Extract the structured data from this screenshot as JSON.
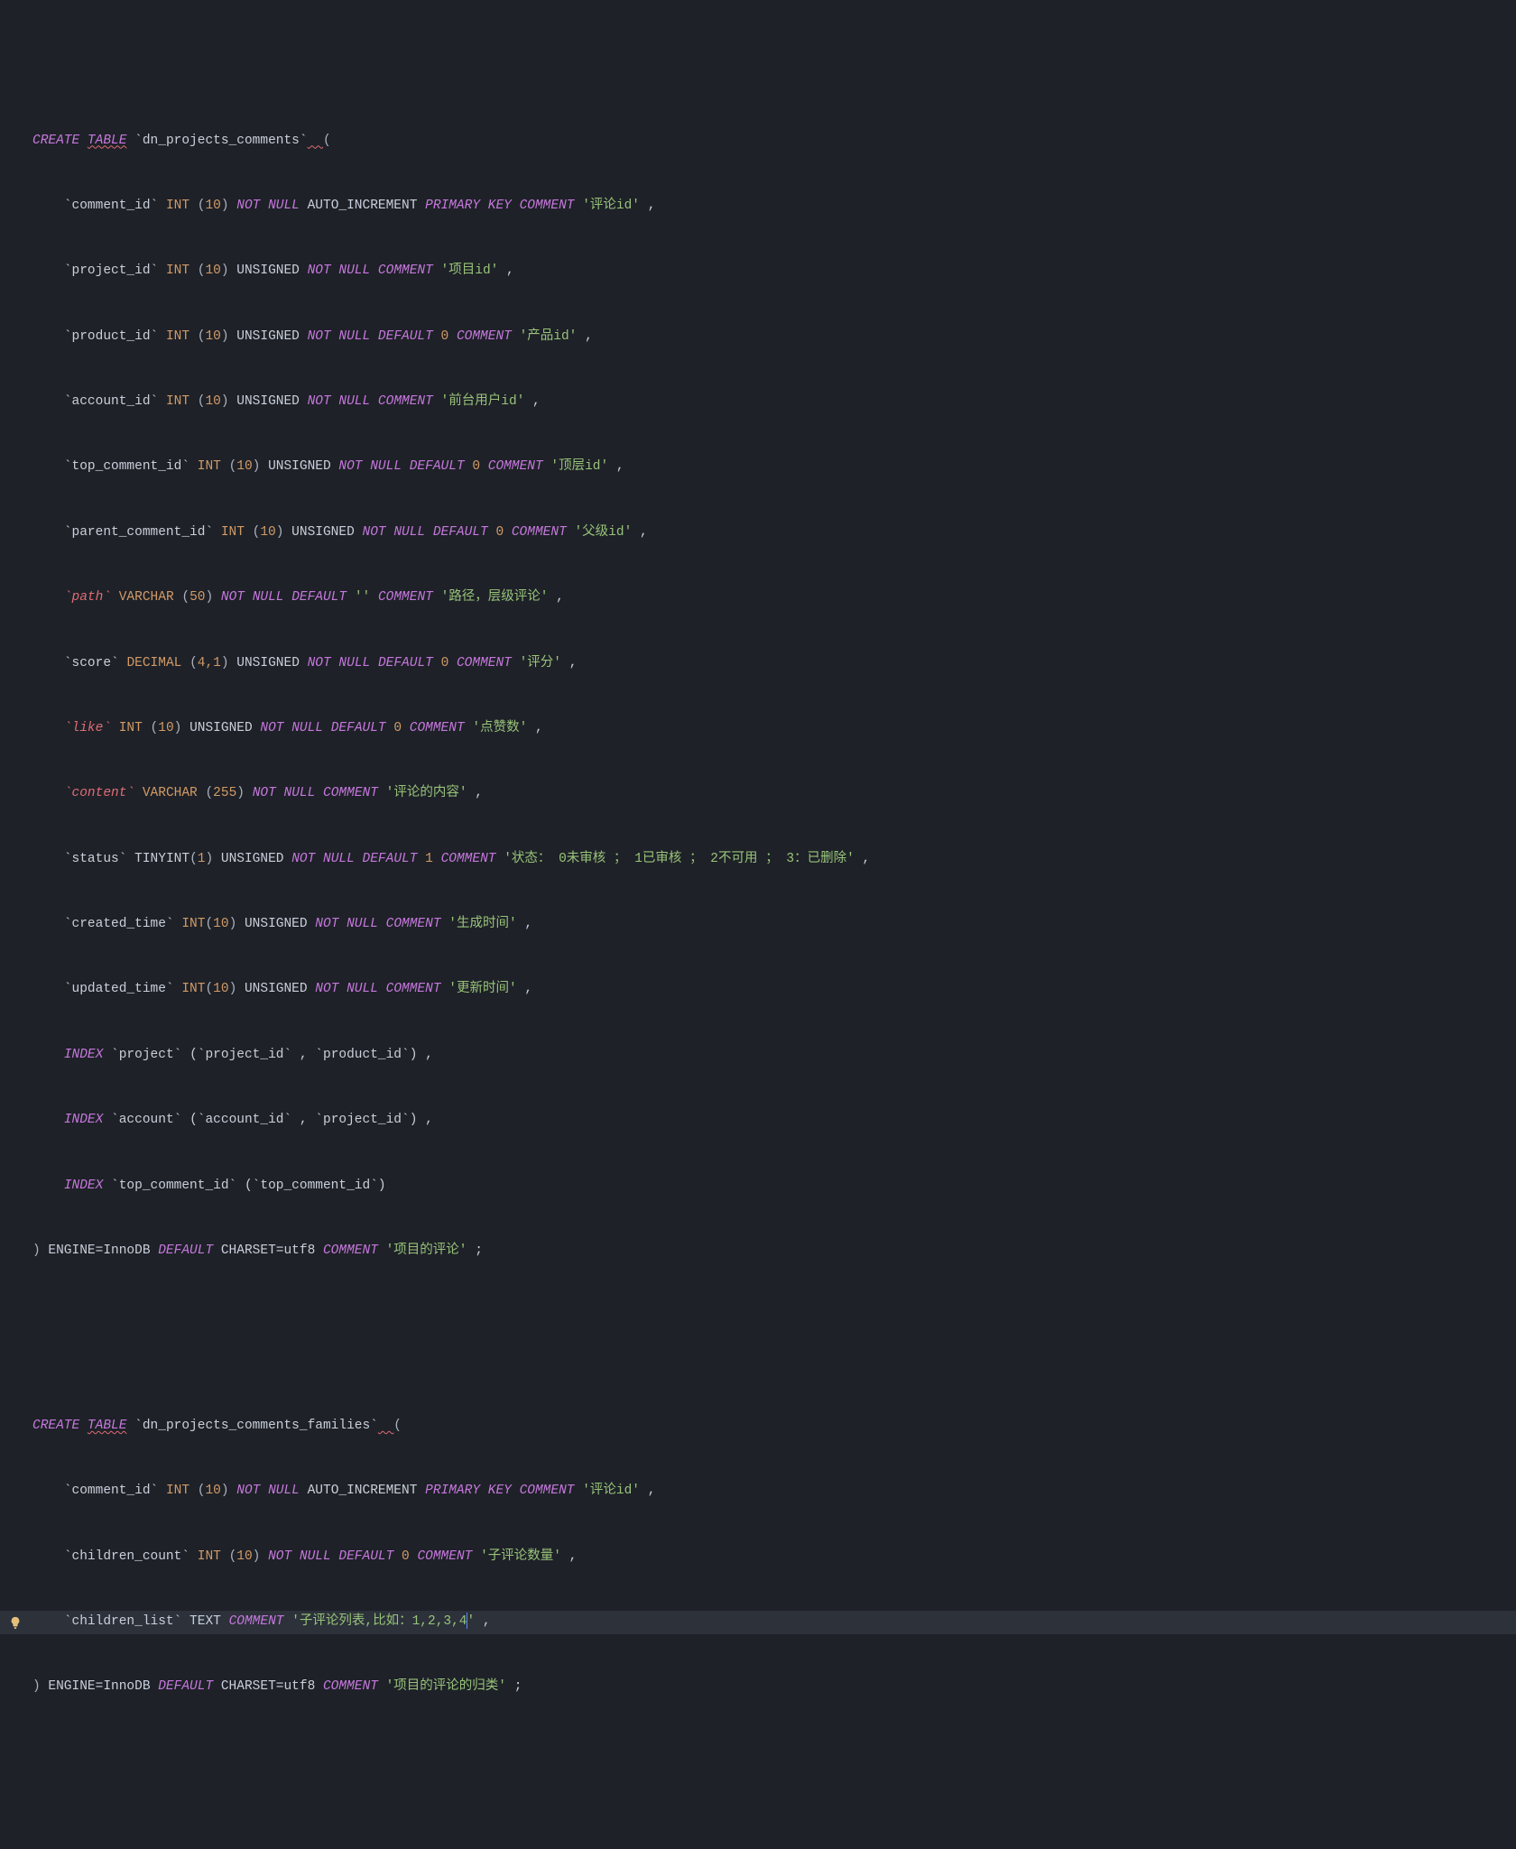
{
  "sql": {
    "create": "CREATE",
    "table": "TABLE",
    "int": "INT",
    "varchar": "VARCHAR",
    "decimal": "DECIMAL",
    "tinyint": "TINYINT",
    "text": "TEXT",
    "not": "NOT",
    "null": "NULL",
    "default": "DEFAULT",
    "comment": "COMMENT",
    "primary": "PRIMARY",
    "key": "KEY",
    "auto_increment": "AUTO_INCREMENT",
    "unsigned": "UNSIGNED",
    "index": "INDEX",
    "engine": "ENGINE=InnoDB",
    "charset": "CHARSET=utf8"
  },
  "t1": {
    "name": "`dn_projects_comments`",
    "cols": {
      "comment_id": "`comment_id`",
      "project_id": "`project_id`",
      "product_id": "`product_id`",
      "account_id": "`account_id`",
      "top_comment_id": "`top_comment_id`",
      "parent_comment_id": "`parent_comment_id`",
      "path": "`path`",
      "score": "`score`",
      "like": "`like`",
      "content": "`content`",
      "status": "`status`",
      "created_time": "`created_time`",
      "updated_time": "`updated_time`"
    },
    "sizes": {
      "n10": "10",
      "n50": "50",
      "n41": "4,1",
      "n255": "255",
      "n1": "1"
    },
    "defaults": {
      "zero": "0",
      "one": "1",
      "empty": "''"
    },
    "comments": {
      "c_comment_id": "'评论id'",
      "c_project_id": "'项目id'",
      "c_product_id": "'产品id'",
      "c_account_id": "'前台用户id'",
      "c_top": "'顶层id'",
      "c_parent": "'父级id'",
      "c_path": "'路径，层级评论'",
      "c_score": "'评分'",
      "c_like": "'点赞数'",
      "c_content": "'评论的内容'",
      "c_status": "'状态： 0未审核 ； 1已审核 ； 2不可用 ； 3：已删除'",
      "c_created": "'生成时间'",
      "c_updated": "'更新时间'",
      "c_table": "'项目的评论'"
    },
    "idx": {
      "project": "`project`",
      "account": "`account`",
      "top": "`top_comment_id`",
      "project_cols": "(`project_id` , `product_id`)",
      "account_cols": "(`account_id` , `project_id`)",
      "top_cols": "(`top_comment_id`)"
    }
  },
  "t2": {
    "name": "`dn_projects_comments_families`",
    "cols": {
      "comment_id": "`comment_id`",
      "children_count": "`children_count`",
      "children_list": "`children_list`"
    },
    "comments": {
      "c_comment_id": "'评论id'",
      "c_children_count": "'子评论数量'",
      "c_children_list_a": "'子评论列表,比如：1,2,3,4",
      "c_children_list_b": "'",
      "c_table": "'项目的评论的归类'"
    }
  },
  "punct": {
    "comma": " ,",
    "semi": " ;",
    "lparen": " (",
    "rparen": ")",
    "space": " "
  }
}
